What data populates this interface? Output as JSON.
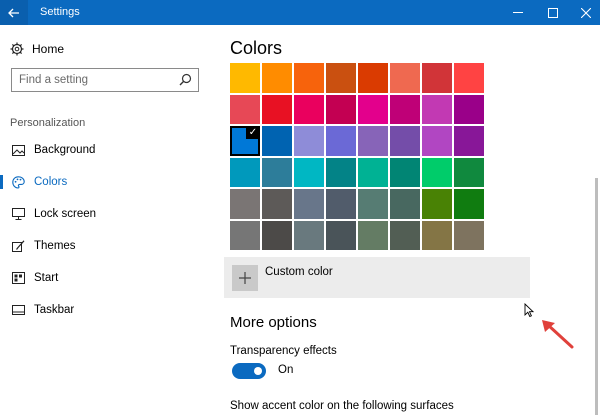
{
  "window": {
    "title": "Settings",
    "accent": "#0b6ac0"
  },
  "sidebar": {
    "home_label": "Home",
    "search_placeholder": "Find a setting",
    "section_label": "Personalization",
    "items": [
      {
        "label": "Background",
        "icon": "image-icon",
        "active": false
      },
      {
        "label": "Colors",
        "icon": "palette-icon",
        "active": true
      },
      {
        "label": "Lock screen",
        "icon": "monitor-icon",
        "active": false
      },
      {
        "label": "Themes",
        "icon": "brush-icon",
        "active": false
      },
      {
        "label": "Start",
        "icon": "start-tiles-icon",
        "active": false
      },
      {
        "label": "Taskbar",
        "icon": "taskbar-icon",
        "active": false
      }
    ]
  },
  "main": {
    "heading": "Colors",
    "palette": [
      [
        "#ffb900",
        "#ff8c00",
        "#f7630c",
        "#ca5010",
        "#da3b01",
        "#ef6950",
        "#d13438",
        "#ff4343"
      ],
      [
        "#e74856",
        "#e81123",
        "#ea005e",
        "#c30052",
        "#e3008c",
        "#bf0077",
        "#c239b3",
        "#9a0089"
      ],
      [
        "#0078d7",
        "#0063b1",
        "#8e8cd8",
        "#6b69d6",
        "#8764b8",
        "#744da9",
        "#b146c2",
        "#881798"
      ],
      [
        "#0099bc",
        "#2d7d9a",
        "#00b7c3",
        "#038387",
        "#00b294",
        "#018574",
        "#00cc6a",
        "#10893e"
      ],
      [
        "#7a7574",
        "#5d5a58",
        "#68768a",
        "#515c6b",
        "#567c73",
        "#486860",
        "#498205",
        "#107c10"
      ],
      [
        "#767676",
        "#4c4a48",
        "#69797e",
        "#4a5459",
        "#647c64",
        "#525e54",
        "#847545",
        "#7e735f"
      ]
    ],
    "selected_color": "#0078d7",
    "custom_color_label": "Custom color",
    "more_options_heading": "More options",
    "transparency_label": "Transparency effects",
    "transparency_state": "On",
    "accent_surfaces_label": "Show accent color on the following surfaces"
  }
}
